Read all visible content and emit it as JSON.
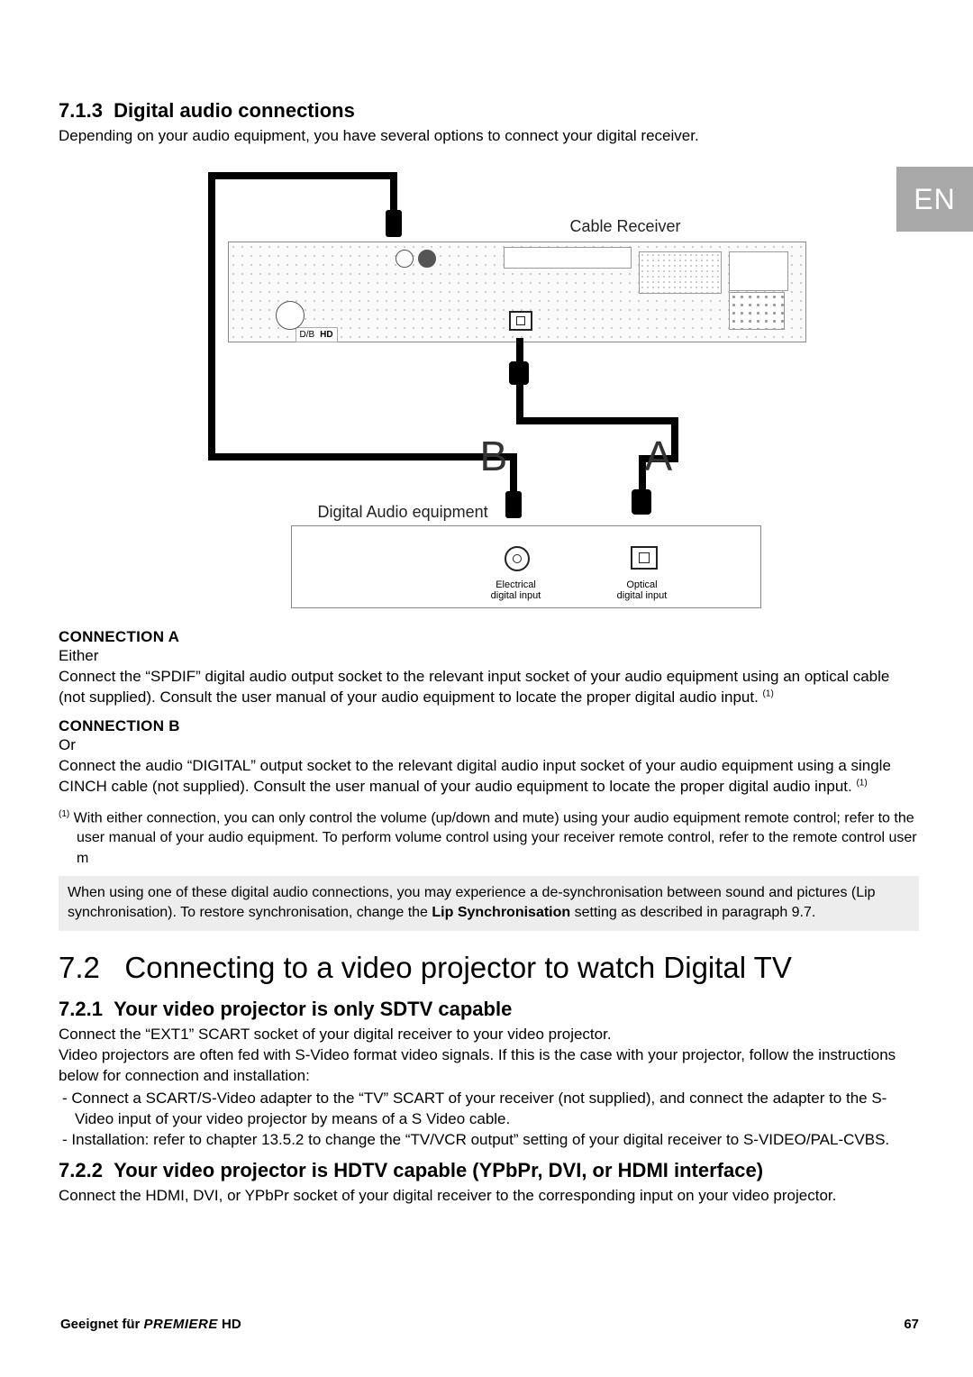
{
  "lang_tab": "EN",
  "s713": {
    "num": "7.1.3",
    "title": "Digital audio connections",
    "intro": "Depending on your audio equipment, you have several options to connect your digital receiver."
  },
  "diagram": {
    "cable_receiver": "Cable Receiver",
    "digital_audio_equipment": "Digital Audio equipment",
    "letter_a": "A",
    "letter_b": "B",
    "caption_elec_1": "Electrical",
    "caption_elec_2": "digital input",
    "caption_opt_1": "Optical",
    "caption_opt_2": "digital input"
  },
  "conn_a": {
    "head": "CONNECTION A",
    "either": "Either",
    "body": "Connect the “SPDIF” digital audio output socket to the relevant input socket of your audio equipment using an optical cable (not supplied). Consult the user manual of your audio equipment to locate the proper digital audio input. ",
    "sup": "(1)"
  },
  "conn_b": {
    "head": "CONNECTION B",
    "or": "Or",
    "body": "Connect the audio “DIGITAL” output socket to the relevant digital audio input socket of your audio equipment using a single CINCH cable (not supplied). Consult the user manual of your audio equipment to locate the proper digital audio input. ",
    "sup": "(1)"
  },
  "footnote": {
    "sup": "(1)",
    "text": " With either connection, you can only control the volume (up/down and mute) using your audio equipment remote control; refer to the user manual of your audio equipment. To perform volume control using your receiver remote control, refer to the remote control user m"
  },
  "infobox": {
    "line1": "When using one of these digital audio connections, you may experience a de-synchronisation between sound and pictures (Lip synchronisation). To restore synchronisation, change the ",
    "bold": "Lip Synchronisation",
    "line2": " setting as described in paragraph 9.7."
  },
  "s72": {
    "num": "7.2",
    "title": "Connecting to a video projector to watch Digital TV"
  },
  "s721": {
    "num": "7.2.1",
    "title": "Your video projector is only SDTV capable",
    "p1": "Connect the “EXT1” SCART socket of your digital receiver to your video projector.",
    "p2": "Video projectors are often fed with S-Video format video signals. If this is the case with your projector, follow the instructions below for connection and installation:",
    "li1": "Connect a SCART/S-Video adapter to the “TV” SCART of your receiver (not supplied), and connect the adapter to the S-Video input of your video projector by means of a S Video cable.",
    "li2": "Installation: refer to chapter 13.5.2 to change the “TV/VCR output” setting of your digital receiver to S-VIDEO/PAL-CVBS."
  },
  "s722": {
    "num": "7.2.2",
    "title": "Your video projector is HDTV capable (YPbPr, DVI, or HDMI interface)",
    "p1": "Connect the HDMI, DVI, or YPbPr socket of your digital receiver to the corresponding input on your video projector."
  },
  "footer": {
    "left_plain": "Geeignet für ",
    "left_brand": "PREMIERE",
    "left_hd": " HD",
    "page": "67"
  }
}
